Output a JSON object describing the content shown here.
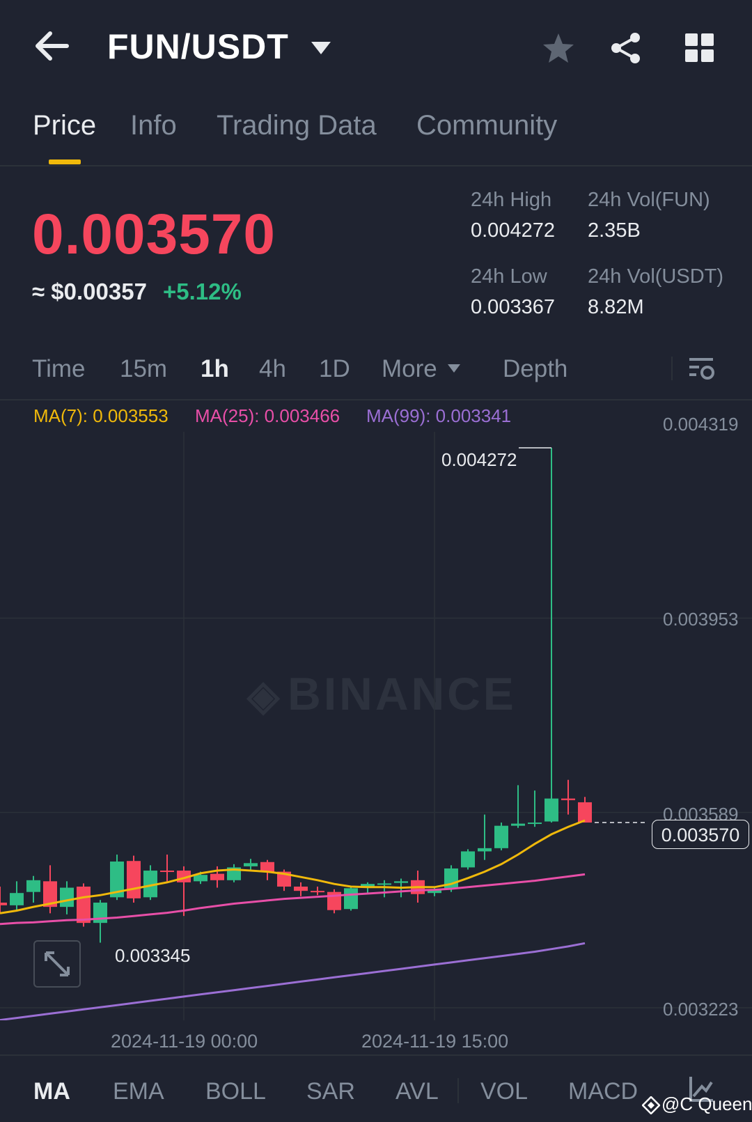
{
  "header": {
    "pair": "FUN/USDT",
    "icons": [
      "back-arrow-icon",
      "chevron-down-icon",
      "star-icon",
      "share-icon",
      "grid-icon"
    ]
  },
  "tabs": [
    {
      "label": "Price",
      "active": true
    },
    {
      "label": "Info",
      "active": false
    },
    {
      "label": "Trading Data",
      "active": false
    },
    {
      "label": "Community",
      "active": false
    }
  ],
  "ticker": {
    "last_price": "0.003570",
    "usd_price": "≈ $0.00357",
    "change": "+5.12%",
    "high_label": "24h High",
    "high_value": "0.004272",
    "low_label": "24h Low",
    "low_value": "0.003367",
    "vol_base_label": "24h Vol(FUN)",
    "vol_base_value": "2.35B",
    "vol_quote_label": "24h Vol(USDT)",
    "vol_quote_value": "8.82M"
  },
  "intervals": {
    "items": [
      "Time",
      "15m",
      "1h",
      "4h",
      "1D",
      "More",
      "Depth"
    ],
    "active": "1h"
  },
  "ma_legend": {
    "ma7": "MA(7): 0.003553",
    "ma25": "MA(25): 0.003466",
    "ma99": "MA(99): 0.003341"
  },
  "colors": {
    "up": "#2ebd85",
    "down": "#f6465d",
    "ma7": "#f0b90b",
    "ma25": "#e84fa8",
    "ma99": "#9b6fd4",
    "accent": "#f0b90b",
    "background": "#1f2330"
  },
  "chart_data": {
    "type": "candlestick",
    "price_axis": [
      "0.004319",
      "0.003953",
      "0.003589",
      "0.003223"
    ],
    "ylim": [
      0.00313,
      0.00437
    ],
    "time_axis": [
      "2024-11-19 00:00",
      "2024-11-19 15:00"
    ],
    "high_annotation": "0.004272",
    "low_annotation": "0.003345",
    "current_price_label": "0.003570",
    "watermark": "BINANCE",
    "candles": [
      {
        "o": 0.00342,
        "h": 0.00345,
        "l": 0.0034,
        "c": 0.003415
      },
      {
        "o": 0.003415,
        "h": 0.00346,
        "l": 0.003405,
        "c": 0.003438
      },
      {
        "o": 0.00344,
        "h": 0.00347,
        "l": 0.00342,
        "c": 0.003462
      },
      {
        "o": 0.00346,
        "h": 0.00349,
        "l": 0.0034,
        "c": 0.003412
      },
      {
        "o": 0.003412,
        "h": 0.00346,
        "l": 0.003398,
        "c": 0.003448
      },
      {
        "o": 0.00345,
        "h": 0.003456,
        "l": 0.003375,
        "c": 0.003382
      },
      {
        "o": 0.003382,
        "h": 0.003425,
        "l": 0.003345,
        "c": 0.00342
      },
      {
        "o": 0.00343,
        "h": 0.00351,
        "l": 0.003425,
        "c": 0.003497
      },
      {
        "o": 0.003498,
        "h": 0.003508,
        "l": 0.00342,
        "c": 0.003428
      },
      {
        "o": 0.00343,
        "h": 0.00349,
        "l": 0.003425,
        "c": 0.00348
      },
      {
        "o": 0.00348,
        "h": 0.00351,
        "l": 0.00346,
        "c": 0.003479
      },
      {
        "o": 0.00348,
        "h": 0.003488,
        "l": 0.003395,
        "c": 0.003458
      },
      {
        "o": 0.00346,
        "h": 0.003478,
        "l": 0.003455,
        "c": 0.003472
      },
      {
        "o": 0.003474,
        "h": 0.003488,
        "l": 0.003448,
        "c": 0.003462
      },
      {
        "o": 0.003462,
        "h": 0.003492,
        "l": 0.003458,
        "c": 0.003486
      },
      {
        "o": 0.003488,
        "h": 0.003502,
        "l": 0.00348,
        "c": 0.003494
      },
      {
        "o": 0.003496,
        "h": 0.0035,
        "l": 0.003462,
        "c": 0.003478
      },
      {
        "o": 0.003478,
        "h": 0.003482,
        "l": 0.003442,
        "c": 0.00345
      },
      {
        "o": 0.00345,
        "h": 0.003458,
        "l": 0.003432,
        "c": 0.003442
      },
      {
        "o": 0.003442,
        "h": 0.00345,
        "l": 0.003434,
        "c": 0.00344
      },
      {
        "o": 0.00344,
        "h": 0.003445,
        "l": 0.0034,
        "c": 0.003406
      },
      {
        "o": 0.003408,
        "h": 0.00345,
        "l": 0.003405,
        "c": 0.003447
      },
      {
        "o": 0.00345,
        "h": 0.003458,
        "l": 0.003438,
        "c": 0.003455
      },
      {
        "o": 0.003455,
        "h": 0.003462,
        "l": 0.00343,
        "c": 0.003456
      },
      {
        "o": 0.003457,
        "h": 0.003465,
        "l": 0.00343,
        "c": 0.00346
      },
      {
        "o": 0.003462,
        "h": 0.00348,
        "l": 0.00342,
        "c": 0.003436
      },
      {
        "o": 0.003438,
        "h": 0.003448,
        "l": 0.003432,
        "c": 0.003444
      },
      {
        "o": 0.003446,
        "h": 0.00349,
        "l": 0.00344,
        "c": 0.003484
      },
      {
        "o": 0.003486,
        "h": 0.00352,
        "l": 0.003482,
        "c": 0.003516
      },
      {
        "o": 0.003516,
        "h": 0.003585,
        "l": 0.0035,
        "c": 0.003522
      },
      {
        "o": 0.003522,
        "h": 0.00357,
        "l": 0.003518,
        "c": 0.003564
      },
      {
        "o": 0.003564,
        "h": 0.00364,
        "l": 0.00356,
        "c": 0.003568
      },
      {
        "o": 0.003568,
        "h": 0.00363,
        "l": 0.003562,
        "c": 0.00357
      },
      {
        "o": 0.003572,
        "h": 0.004272,
        "l": 0.00357,
        "c": 0.003615
      },
      {
        "o": 0.003615,
        "h": 0.00365,
        "l": 0.003585,
        "c": 0.003612
      },
      {
        "o": 0.003608,
        "h": 0.003618,
        "l": 0.00357,
        "c": 0.00357
      }
    ],
    "ma7": [
      0.0034,
      0.003405,
      0.003412,
      0.003418,
      0.003424,
      0.00343,
      0.003434,
      0.00344,
      0.003446,
      0.003452,
      0.003458,
      0.003466,
      0.003475,
      0.00348,
      0.003482,
      0.00348,
      0.003478,
      0.003474,
      0.003468,
      0.003462,
      0.003455,
      0.00345,
      0.003449,
      0.003449,
      0.003448,
      0.003449,
      0.003449,
      0.003455,
      0.003466,
      0.003478,
      0.003492,
      0.00351,
      0.00353,
      0.003548,
      0.003562,
      0.003574
    ],
    "ma25": [
      0.00338,
      0.003382,
      0.003383,
      0.003385,
      0.003387,
      0.003388,
      0.00339,
      0.003392,
      0.003395,
      0.003398,
      0.003401,
      0.003405,
      0.00341,
      0.003414,
      0.003418,
      0.003421,
      0.003424,
      0.003427,
      0.003429,
      0.003431,
      0.003433,
      0.003435,
      0.003437,
      0.003439,
      0.003441,
      0.003443,
      0.003444,
      0.003446,
      0.003449,
      0.003452,
      0.003455,
      0.003458,
      0.003461,
      0.003465,
      0.003469,
      0.003473
    ],
    "ma99": [
      0.0032,
      0.003204,
      0.003208,
      0.003212,
      0.003216,
      0.00322,
      0.003224,
      0.003228,
      0.003232,
      0.003236,
      0.00324,
      0.003244,
      0.003248,
      0.003252,
      0.003256,
      0.00326,
      0.003264,
      0.003268,
      0.003272,
      0.003276,
      0.00328,
      0.003284,
      0.003288,
      0.003292,
      0.003296,
      0.0033,
      0.003304,
      0.003308,
      0.003312,
      0.003316,
      0.00332,
      0.003324,
      0.003328,
      0.003333,
      0.003338,
      0.003344
    ]
  },
  "indicators": {
    "items": [
      "MA",
      "EMA",
      "BOLL",
      "SAR",
      "AVL",
      "VOL",
      "MACD"
    ],
    "active": "MA"
  },
  "credit": "@C Queen"
}
